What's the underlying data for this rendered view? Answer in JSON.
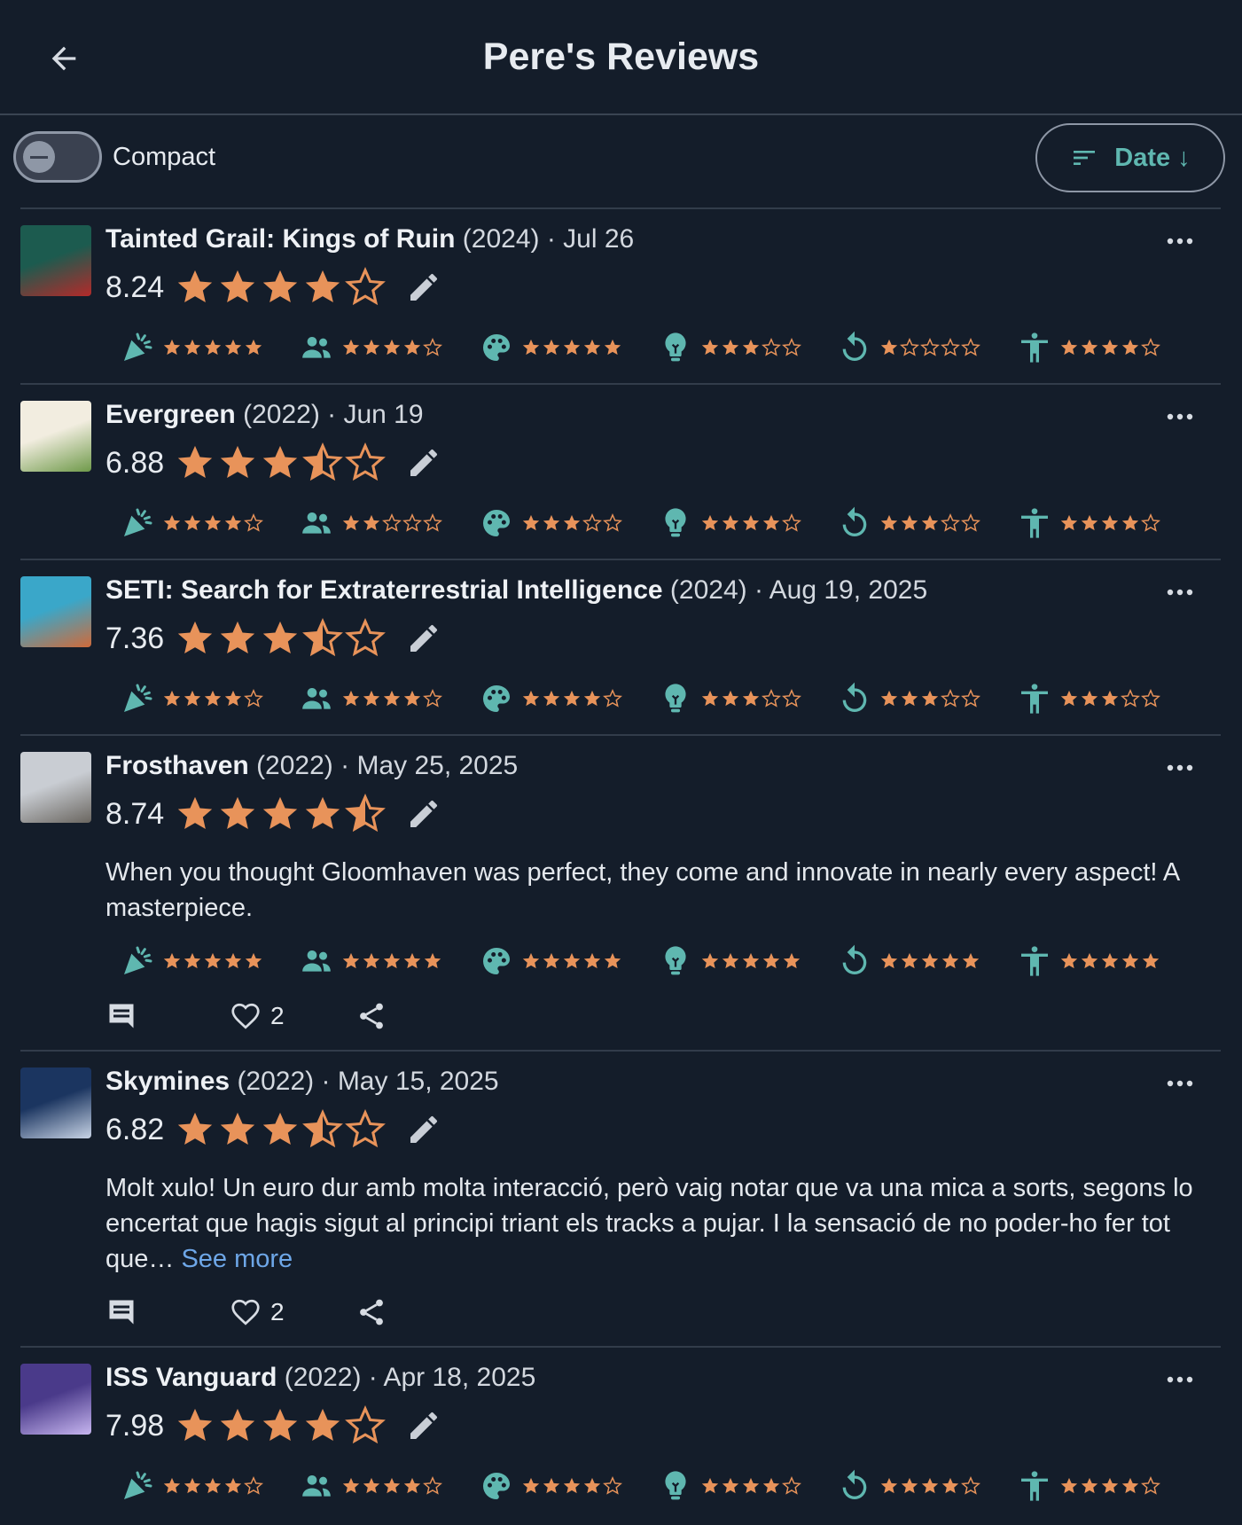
{
  "header": {
    "title": "Pere's Reviews"
  },
  "toolbar": {
    "compact_label": "Compact",
    "sort_label": "Date ↓"
  },
  "colors": {
    "accent": "#5fb7b0",
    "star": "#e8935a",
    "background": "#141d2a",
    "link": "#6ea7e8"
  },
  "category_icons": [
    "party-popper-icon",
    "people-icon",
    "palette-icon",
    "lightbulb-icon",
    "replay-icon",
    "accessibility-icon"
  ],
  "reviews": [
    {
      "name": "Tainted Grail: Kings of Ruin",
      "year": "(2024)",
      "date": " · Jul 26",
      "score": "8.24",
      "stars": 4,
      "thumb": [
        "#1c5b4f",
        "#b42a2a"
      ],
      "cats": [
        5,
        4,
        5,
        3,
        1,
        4
      ],
      "comment": "",
      "likes": null
    },
    {
      "name": "Evergreen",
      "year": "(2022)",
      "date": " · Jun 19",
      "score": "6.88",
      "stars": 3.5,
      "thumb": [
        "#f2ede0",
        "#6f9a4a"
      ],
      "cats": [
        4,
        2,
        3,
        4,
        3,
        4
      ],
      "comment": "",
      "likes": null
    },
    {
      "name": "SETI: Search for Extraterrestrial Intelligence",
      "year": "(2024)",
      "date": " · Aug 19, 2025",
      "score": "7.36",
      "stars": 3.5,
      "thumb": [
        "#3aa7c9",
        "#d06a3a"
      ],
      "cats": [
        4,
        4,
        4,
        3,
        3,
        3
      ],
      "comment": "",
      "likes": null
    },
    {
      "name": "Frosthaven",
      "year": "(2022)",
      "date": " · May 25, 2025",
      "score": "8.74",
      "stars": 4.5,
      "thumb": [
        "#c9cdd3",
        "#6a6660"
      ],
      "cats": [
        5,
        5,
        5,
        5,
        5,
        5
      ],
      "comment": "When you thought Gloomhaven was perfect, they come and innovate in nearly every aspect! A masterpiece.",
      "likes": "2"
    },
    {
      "name": "Skymines",
      "year": "(2022)",
      "date": " · May 15, 2025",
      "score": "6.82",
      "stars": 3.5,
      "thumb": [
        "#1b3560",
        "#c8d4e6"
      ],
      "cats": null,
      "comment": "Molt xulo! Un euro dur amb molta interacció, però vaig notar que va una mica a sorts, segons lo encertat que hagis sigut al principi triant els tracks a pujar. I la sensació de no poder-ho fer tot que…",
      "see_more": "See more",
      "likes": "2"
    },
    {
      "name": "ISS Vanguard",
      "year": "(2022)",
      "date": " · Apr 18, 2025",
      "score": "7.98",
      "stars": 4,
      "thumb": [
        "#4a3a8a",
        "#c7b6f0"
      ],
      "cats": [
        4,
        4,
        4,
        4,
        4,
        4
      ],
      "comment": "",
      "likes": null
    }
  ]
}
